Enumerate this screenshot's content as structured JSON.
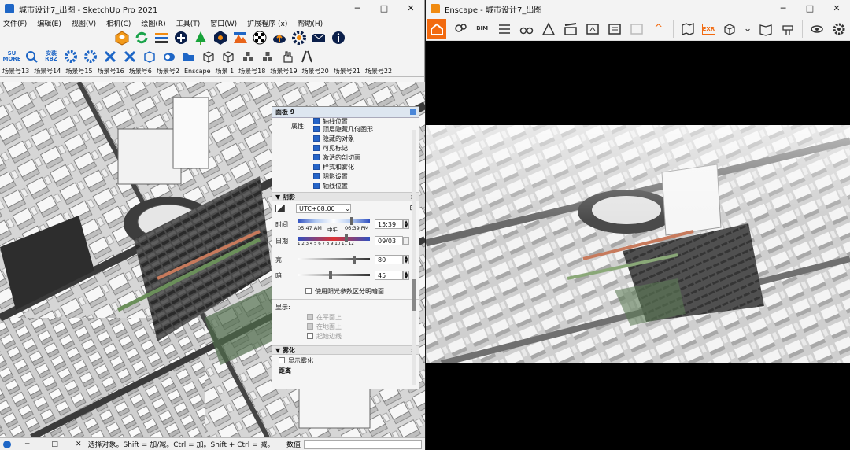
{
  "sketchup": {
    "title": "城市设计7_出图 - SketchUp Pro 2021",
    "menu": [
      "文件(F)",
      "编辑(E)",
      "视图(V)",
      "相机(C)",
      "绘图(R)",
      "工具(T)",
      "窗口(W)",
      "扩展程序 (x)",
      "帮助(H)"
    ],
    "toolbar1_icons": [
      "enscape-logo-icon",
      "refresh-icon",
      "layers-icon",
      "add-circle-icon",
      "tree-icon",
      "hexagon-icon",
      "mountain-icon",
      "checker-icon",
      "cloud-upload-icon",
      "gear-icon",
      "mail-icon",
      "info-icon"
    ],
    "toolbar2_labels": {
      "su_more": "SU MORE",
      "install": "安装 RBZ"
    },
    "toolbar2_icons": [
      "search-icon",
      "gear-icon",
      "gear-icon",
      "tools-icon",
      "tools-icon",
      "cube-icon",
      "toggle-icon",
      "folder-icon",
      "cube-icon",
      "cube-icon",
      "cubes-icon",
      "cubes-icon",
      "hand-icon",
      "road-icon"
    ],
    "tabs": [
      "场景号13",
      "场景号14",
      "场景号15",
      "场景号16",
      "场景号6",
      "场景号2",
      "Enscape",
      "场景 1",
      "场景号18",
      "场景号19",
      "场景号20",
      "场景号21",
      "场景号22"
    ],
    "status_text": "选择对象。Shift = 加/减。Ctrl = 加。Shift + Ctrl = 减。",
    "status_value_label": "数值"
  },
  "panel": {
    "title": "面板 9",
    "props_label": "属性:",
    "checks": [
      {
        "label": "轴线位置",
        "checked": true
      },
      {
        "label": "顶层隐藏几何图形",
        "checked": true
      },
      {
        "label": "隐藏的对象",
        "checked": true
      },
      {
        "label": "可见标记",
        "checked": true
      },
      {
        "label": "激活的剖切面",
        "checked": true
      },
      {
        "label": "样式和雾化",
        "checked": true
      },
      {
        "label": "阴影设置",
        "checked": true
      },
      {
        "label": "轴线位置",
        "checked": true
      }
    ],
    "shadow_section": "阴影",
    "timezone": "UTC+08:00",
    "time_label": "时间",
    "sunrise": "05:47 AM",
    "noon": "中午",
    "sunset": "06:39 PM",
    "time_value": "15:39",
    "date_label": "日期",
    "months": "1 2 3 4 5 6 7 8 9 10 11 12",
    "date_value": "09/03",
    "light_label": "亮",
    "light_value": "80",
    "dark_label": "暗",
    "dark_value": "45",
    "time_frac": 0.76,
    "date_frac": 0.68,
    "light_frac": 0.8,
    "dark_frac": 0.45,
    "use_sun_label": "使用阳光参数区分明暗面",
    "display_label": "显示:",
    "on_faces": "在平面上",
    "on_ground": "在地面上",
    "from_edges": "起始边线",
    "fog_section": "雾化",
    "show_fog": "显示雾化",
    "distance_label": "距离"
  },
  "enscape": {
    "title": "Enscape - 城市设计7_出图",
    "toolbar_icons": [
      "home-icon",
      "map-pin-icon",
      "bim-icon",
      "list-icon",
      "binoculars-icon",
      "walk-icon",
      "clapper-icon",
      "export-icon",
      "export-batch-icon",
      "export-360-icon",
      "chevron-up-icon",
      "map-icon",
      "exr-icon",
      "cube-icon",
      "chevron-down-icon",
      "book-icon",
      "tools-icon",
      "eye-icon",
      "gear-icon"
    ],
    "bim_label": "BIM",
    "exr_label": "EXR"
  }
}
